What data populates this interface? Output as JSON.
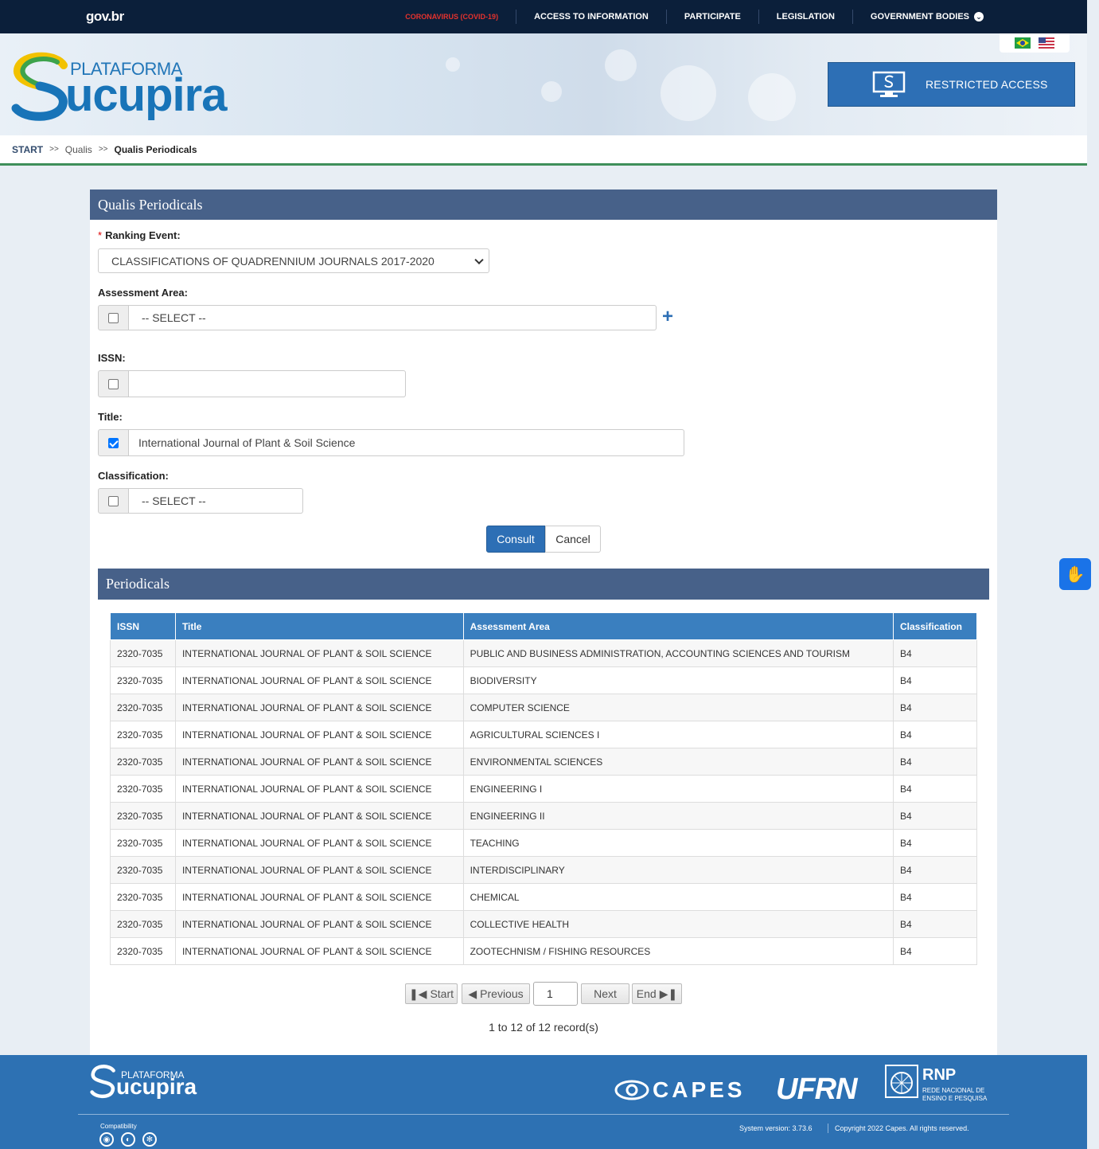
{
  "govbar": {
    "logo": "gov.br",
    "nav": [
      "CORONAVIRUS (COVID-19)",
      "ACCESS TO INFORMATION",
      "PARTICIPATE",
      "LEGISLATION",
      "GOVERNMENT BODIES"
    ]
  },
  "brand": {
    "prefix": "PLATAFORMA",
    "name": "ucupira"
  },
  "header": {
    "restricted_label": "RESTRICTED ACCESS"
  },
  "breadcrumb": {
    "start": "START",
    "sep": ">>",
    "middle": "Qualis",
    "current": "Qualis Periodicals"
  },
  "form": {
    "title": "Qualis Periodicals",
    "ranking_event": {
      "required_mark": "*",
      "label": "Ranking Event:",
      "value": "CLASSIFICATIONS OF QUADRENNIUM JOURNALS 2017-2020"
    },
    "assessment_area": {
      "label": "Assessment Area:",
      "value": "-- SELECT --",
      "checked": false
    },
    "issn": {
      "label": "ISSN:",
      "value": "",
      "checked": false
    },
    "title_field": {
      "label": "Title:",
      "value": "International Journal of Plant & Soil Science",
      "checked": true
    },
    "classification": {
      "label": "Classification:",
      "value": "-- SELECT --",
      "checked": false
    },
    "consult_label": "Consult",
    "cancel_label": "Cancel"
  },
  "results": {
    "title": "Periodicals",
    "columns": [
      "ISSN",
      "Title",
      "Assessment Area",
      "Classification"
    ],
    "rows": [
      [
        "2320-7035",
        "INTERNATIONAL JOURNAL OF PLANT & SOIL SCIENCE",
        "PUBLIC AND BUSINESS ADMINISTRATION, ACCOUNTING SCIENCES AND TOURISM",
        "B4"
      ],
      [
        "2320-7035",
        "INTERNATIONAL JOURNAL OF PLANT & SOIL SCIENCE",
        "BIODIVERSITY",
        "B4"
      ],
      [
        "2320-7035",
        "INTERNATIONAL JOURNAL OF PLANT & SOIL SCIENCE",
        "COMPUTER SCIENCE",
        "B4"
      ],
      [
        "2320-7035",
        "INTERNATIONAL JOURNAL OF PLANT & SOIL SCIENCE",
        "AGRICULTURAL SCIENCES I",
        "B4"
      ],
      [
        "2320-7035",
        "INTERNATIONAL JOURNAL OF PLANT & SOIL SCIENCE",
        "ENVIRONMENTAL SCIENCES",
        "B4"
      ],
      [
        "2320-7035",
        "INTERNATIONAL JOURNAL OF PLANT & SOIL SCIENCE",
        "ENGINEERING I",
        "B4"
      ],
      [
        "2320-7035",
        "INTERNATIONAL JOURNAL OF PLANT & SOIL SCIENCE",
        "ENGINEERING II",
        "B4"
      ],
      [
        "2320-7035",
        "INTERNATIONAL JOURNAL OF PLANT & SOIL SCIENCE",
        "TEACHING",
        "B4"
      ],
      [
        "2320-7035",
        "INTERNATIONAL JOURNAL OF PLANT & SOIL SCIENCE",
        "INTERDISCIPLINARY",
        "B4"
      ],
      [
        "2320-7035",
        "INTERNATIONAL JOURNAL OF PLANT & SOIL SCIENCE",
        "CHEMICAL",
        "B4"
      ],
      [
        "2320-7035",
        "INTERNATIONAL JOURNAL OF PLANT & SOIL SCIENCE",
        "COLLECTIVE HEALTH",
        "B4"
      ],
      [
        "2320-7035",
        "INTERNATIONAL JOURNAL OF PLANT & SOIL SCIENCE",
        "ZOOTECHNISM / FISHING RESOURCES",
        "B4"
      ]
    ],
    "pager": {
      "start": "Start",
      "previous": "Previous",
      "page": "1",
      "next": "Next",
      "end": "End"
    },
    "records_text": "1 to 12 of 12 record(s)"
  },
  "footer": {
    "brand_prefix": "PLATAFORMA",
    "brand_name": "ucupira",
    "partners": [
      "CAPES",
      "UFRN",
      "RNP"
    ],
    "rnp_sub1": "REDE NACIONAL DE",
    "rnp_sub2": "ENSINO E PESQUISA",
    "compat_label": "Compatibility",
    "system_version": "System version: 3.73.6",
    "copyright": "Copyright 2022 Capes. All rights reserved."
  },
  "colors": {
    "govbar": "#0b1f3a",
    "accent": "#2d6fb5",
    "panel_head": "#476189",
    "table_head": "#3a7fbf",
    "footer": "#2d71b3"
  }
}
